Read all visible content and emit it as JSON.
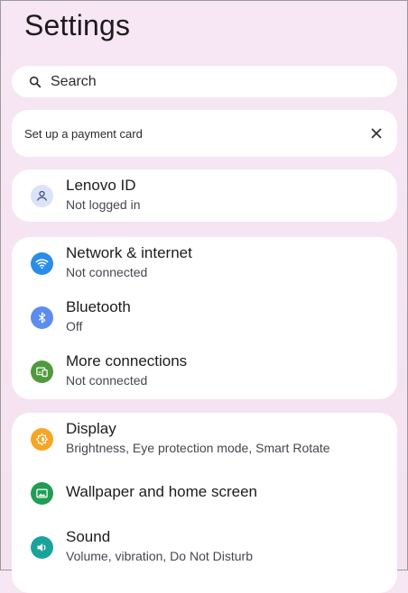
{
  "header": {
    "title": "Settings"
  },
  "search": {
    "label": "Search"
  },
  "payment_card": {
    "text": "Set up a payment card"
  },
  "account_card": {
    "item": {
      "title": "Lenovo ID",
      "subtitle": "Not logged in",
      "icon": "account-icon",
      "color": "#dbe3f8"
    }
  },
  "connectivity_card": {
    "items": [
      {
        "title": "Network & internet",
        "subtitle": "Not connected",
        "icon": "wifi-icon",
        "color": "#2a8de8"
      },
      {
        "title": "Bluetooth",
        "subtitle": "Off",
        "icon": "bluetooth-icon",
        "color": "#5b8def"
      },
      {
        "title": "More connections",
        "subtitle": "Not connected",
        "icon": "devices-icon",
        "color": "#4e9a3c"
      }
    ]
  },
  "device_card": {
    "items": [
      {
        "title": "Display",
        "subtitle": "Brightness, Eye protection mode, Smart Rotate",
        "icon": "display-icon",
        "color": "#f5a623"
      },
      {
        "title": "Wallpaper and home screen",
        "subtitle": "",
        "icon": "wallpaper-icon",
        "color": "#1f9d55"
      },
      {
        "title": "Sound",
        "subtitle": "Volume, vibration, Do Not Disturb",
        "icon": "sound-icon",
        "color": "#1aa39a"
      }
    ]
  }
}
